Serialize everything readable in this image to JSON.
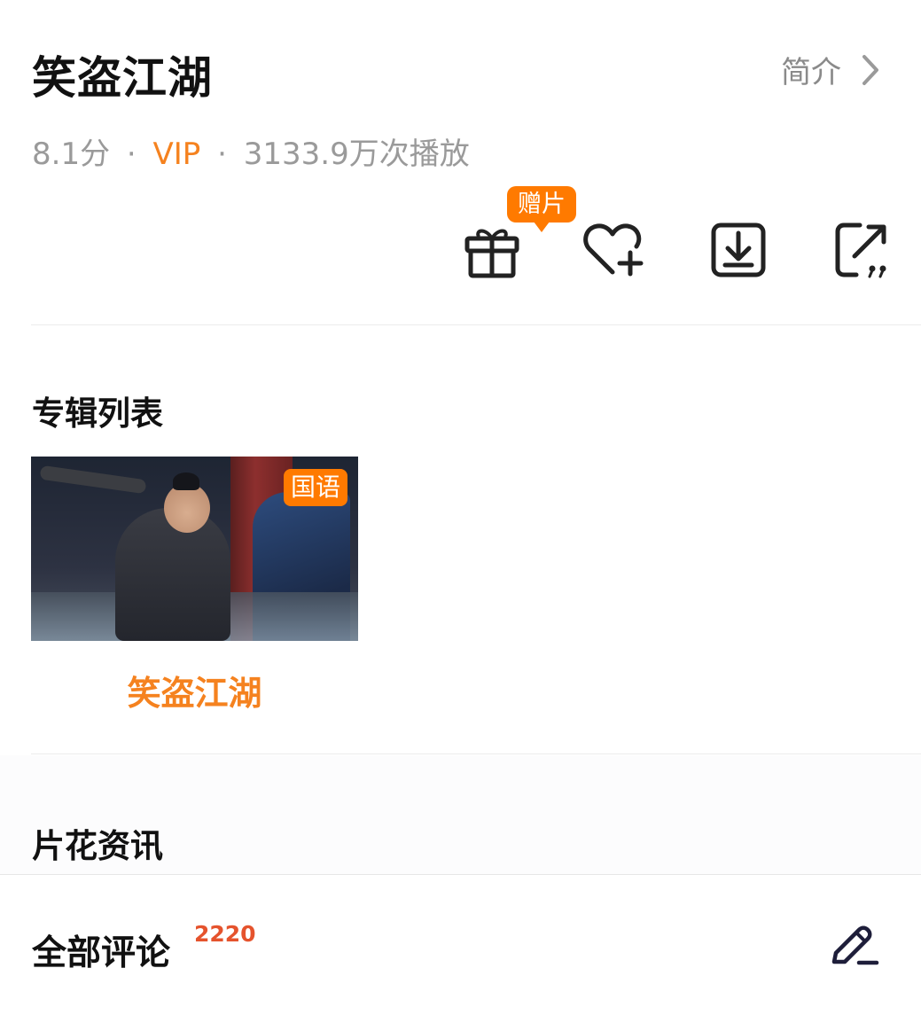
{
  "header": {
    "title": "笑盗江湖",
    "intro_label": "简介"
  },
  "meta": {
    "score": "8.1分",
    "separator": "·",
    "vip": "VIP",
    "plays": "3133.9万次播放"
  },
  "actions": {
    "gift_badge": "赠片",
    "icons": [
      "gift-icon",
      "favorite-add-icon",
      "download-icon",
      "share-icon"
    ]
  },
  "album_section": {
    "title": "专辑列表",
    "items": [
      {
        "name": "笑盗江湖",
        "badge": "国语"
      }
    ]
  },
  "clips_section": {
    "title": "片花资讯"
  },
  "comments": {
    "title": "全部评论",
    "count": "2220"
  },
  "colors": {
    "accent": "#ff7a00",
    "vip": "#f5821f",
    "count": "#e5532d"
  }
}
